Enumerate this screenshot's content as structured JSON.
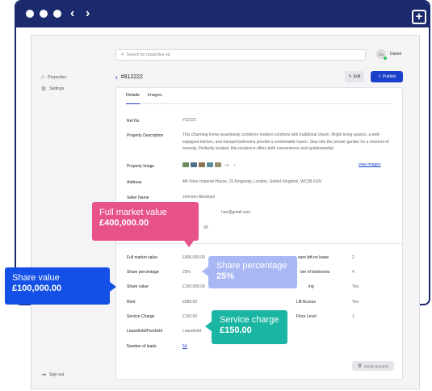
{
  "browser": {
    "back_icon": "chevron-left-icon",
    "forward_icon": "chevron-right-icon",
    "new_tab_icon": "plus-icon"
  },
  "sidebar": {
    "items": [
      {
        "label": "Properties",
        "icon": "home-icon"
      },
      {
        "label": "Settings",
        "icon": "gear-icon"
      }
    ],
    "sign_out": "Sign out"
  },
  "search": {
    "placeholder": "Search for properties etc"
  },
  "user": {
    "initials": "DS",
    "name": "Daniel"
  },
  "header": {
    "title": "#812222",
    "edit_label": "Edit",
    "publish_label": "Publish"
  },
  "tabs": [
    {
      "label": "Details"
    },
    {
      "label": "Images"
    }
  ],
  "details": {
    "ref_label": "Ref No",
    "ref_value": "#12222",
    "desc_label": "Property Description",
    "desc_value": "This charming home seamlessly combines modern comforts with traditional charm. Bright living spaces, a well-equipped kitchen, and tranquil bedrooms provide a comfortable haven. Step into the private garden for a moment of serenity. Perfectly located, this residence offers both convenience and quintessential",
    "image_label": "Property Image",
    "image_more": "+9",
    "image_add": "+",
    "view_images": "view images",
    "address_label": "Address",
    "address_value": "4th Floor Imperial House, 15 Kingsway, London, United Kingdom, WC2B 6UN",
    "seller_label": "Seller Name",
    "seller_value": "Johnson Abraham",
    "email_value": "han@gmail.com",
    "price_partial": "00"
  },
  "financial": {
    "left": [
      {
        "label": "Full market value",
        "value": "£400,000.00"
      },
      {
        "label": "Share percentage",
        "value": "25%"
      },
      {
        "label": "Share value",
        "value": "£100,000.00"
      },
      {
        "label": "Rent",
        "value": "£680.00"
      },
      {
        "label": "Service Charge",
        "value": "£150.00"
      },
      {
        "label": "Leasehold/Freehold",
        "value": "Leasehold"
      },
      {
        "label": "Number of leads",
        "value": "54"
      }
    ],
    "right": [
      {
        "label": "ears left on lease",
        "value": "2"
      },
      {
        "label": "ber of bedrooms",
        "value": "4"
      },
      {
        "label": "ing",
        "value": "Yes"
      },
      {
        "label": "Lift Access",
        "value": "Yes"
      },
      {
        "label": "Floor Level",
        "value": "1"
      }
    ],
    "delete_label": "Delete property"
  },
  "callouts": {
    "full": {
      "title": "Full market value",
      "value": "£400,000.00",
      "color": "#e8528a"
    },
    "share": {
      "title": "Share value",
      "value": "£100,000.00",
      "color": "#1450e6"
    },
    "pct": {
      "title": "Share percentage",
      "value": "25%",
      "color": "#a9b8f5"
    },
    "svc": {
      "title": "Service charge",
      "value": "£150.00",
      "color": "#1bb5a3"
    }
  }
}
